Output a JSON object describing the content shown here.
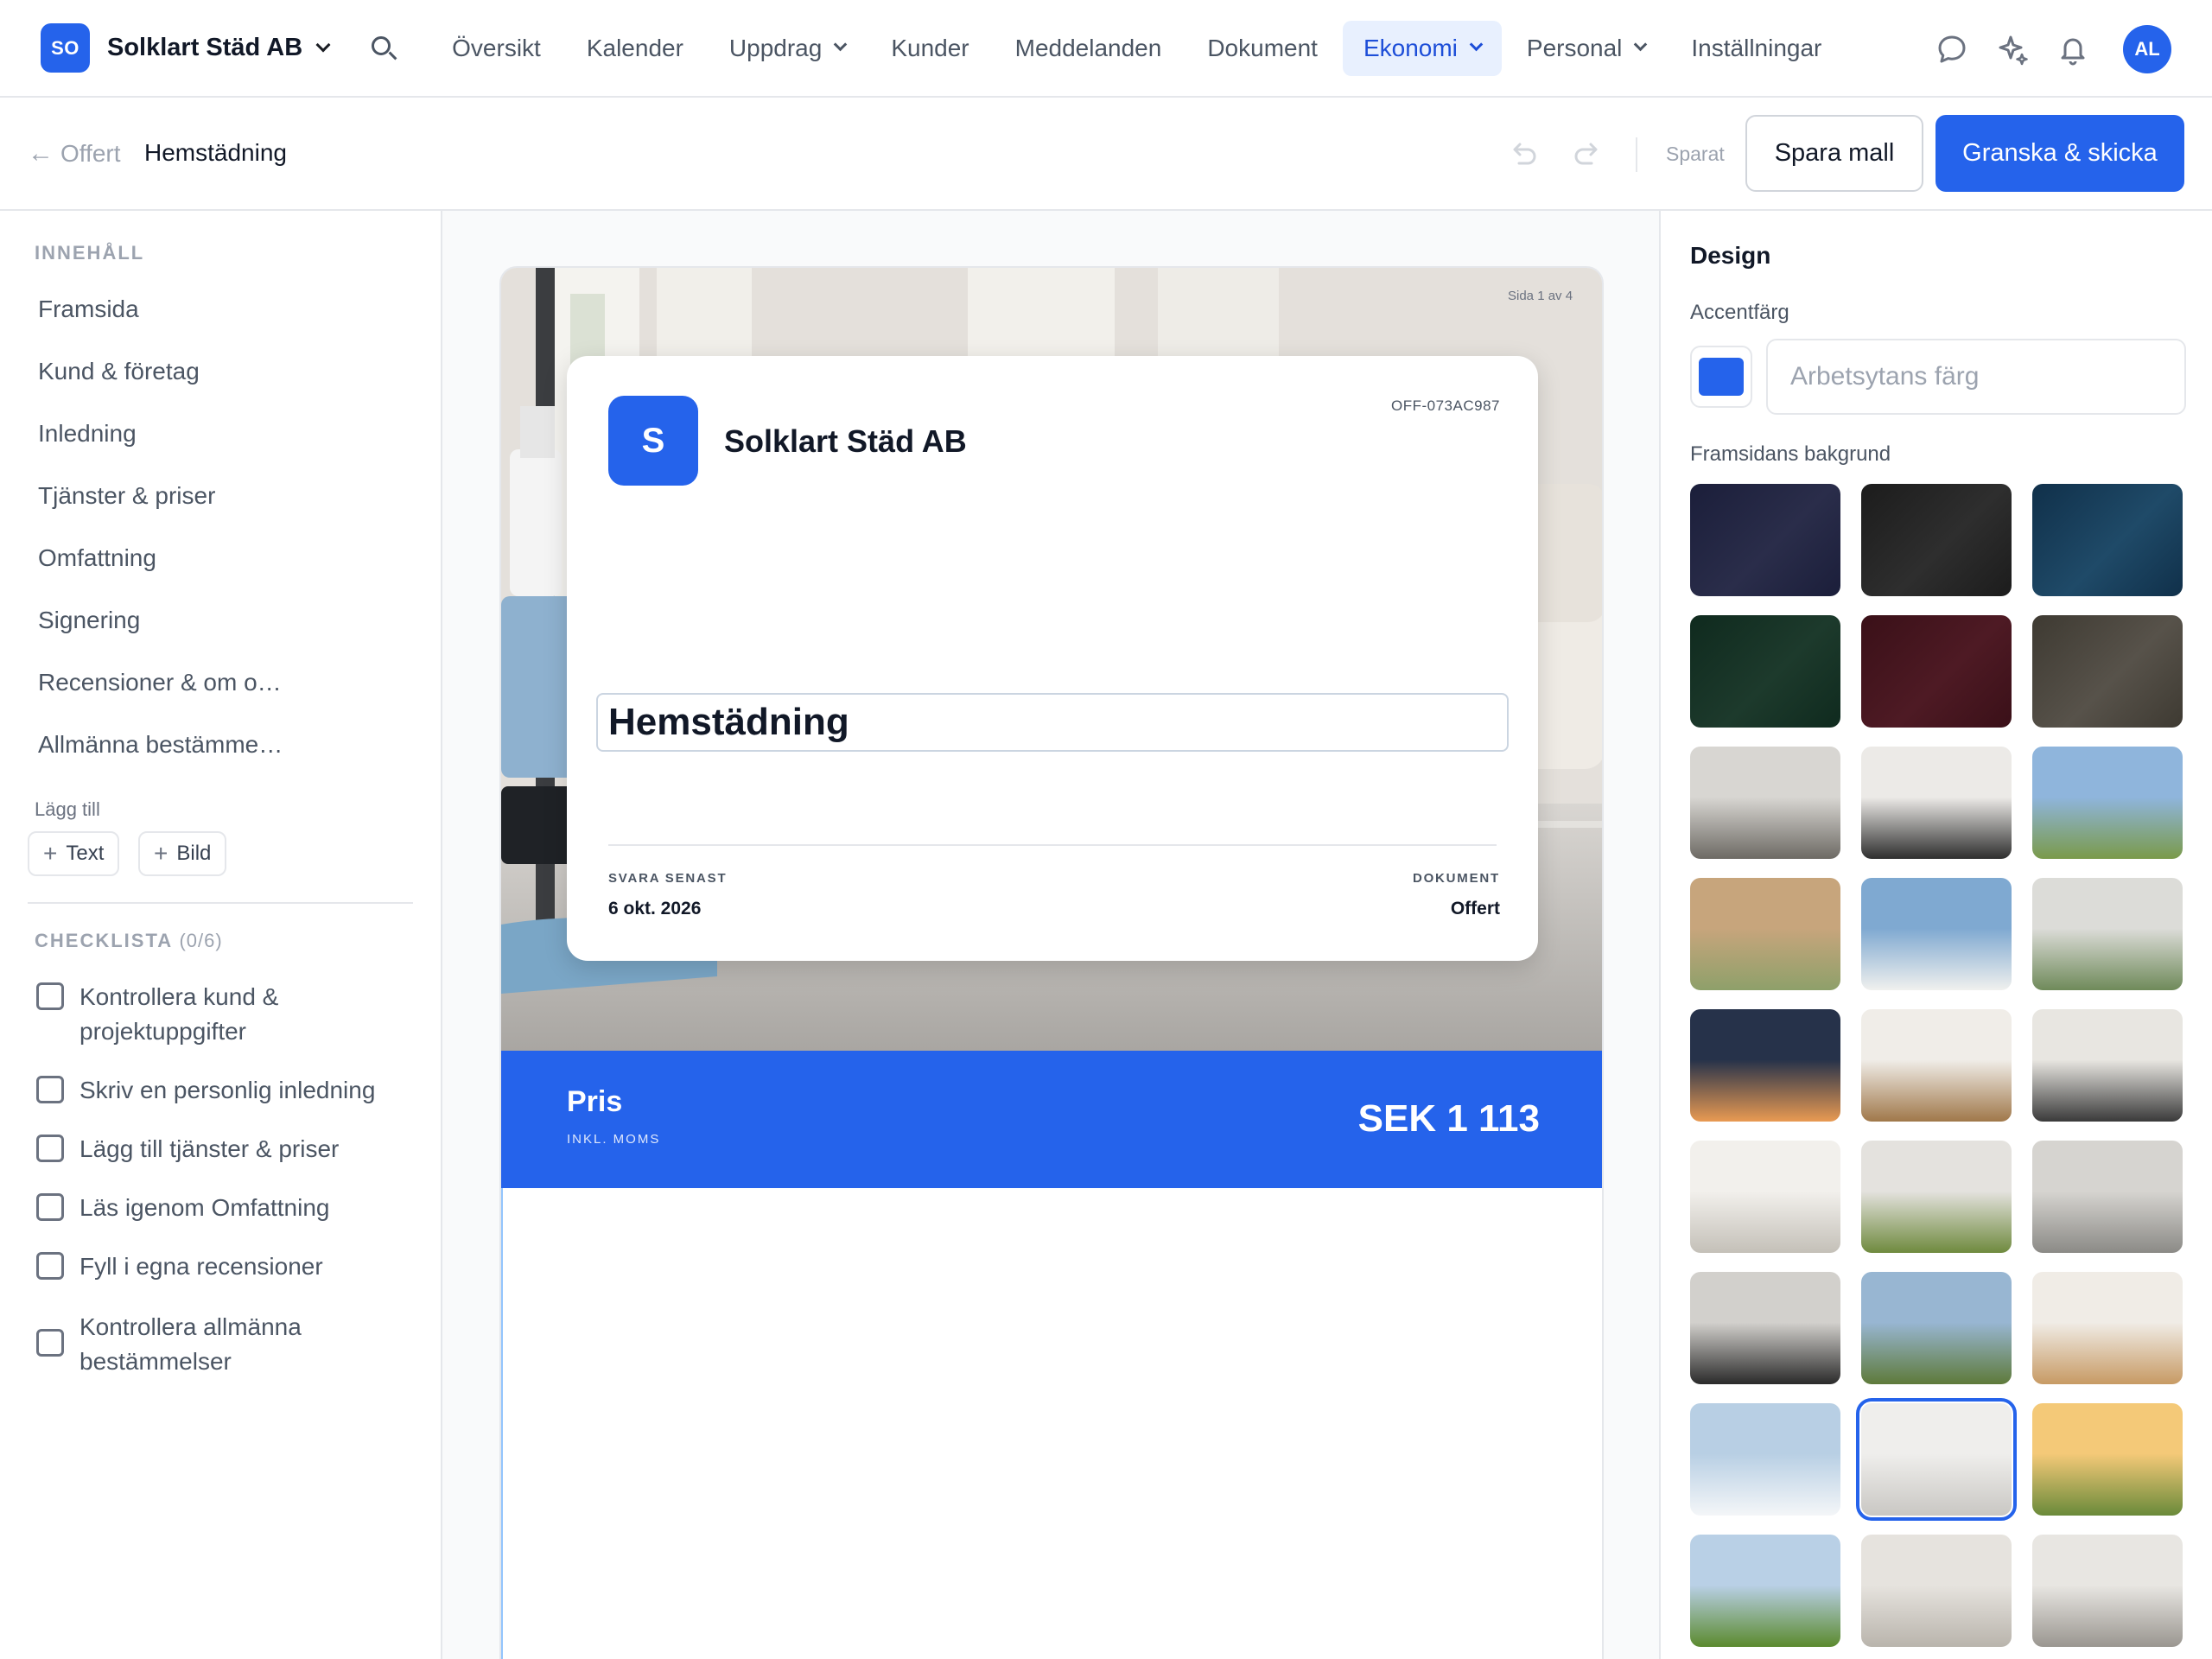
{
  "topnav": {
    "brand_initials": "SO",
    "brand_name": "Solklart Städ AB",
    "links": [
      "Översikt",
      "Kalender",
      "Uppdrag",
      "Kunder",
      "Meddelanden",
      "Dokument",
      "Ekonomi",
      "Personal",
      "Inställningar"
    ],
    "active_link": "Ekonomi",
    "avatar_initials": "AL",
    "icons": [
      "search-icon",
      "chat-icon",
      "sparkle-icon",
      "bell-icon"
    ]
  },
  "subbar": {
    "back_label": "Offert",
    "title": "Hemstädning",
    "saved_label": "Sparat",
    "save_template_label": "Spara mall",
    "review_send_label": "Granska & skicka"
  },
  "sidebar": {
    "content_title": "INNEHÅLL",
    "items": [
      "Framsida",
      "Kund & företag",
      "Inledning",
      "Tjänster & priser",
      "Omfattning",
      "Signering",
      "Recensioner & om o…",
      "Allmänna bestämme…"
    ],
    "add_label": "Lägg till",
    "add_text_label": "Text",
    "add_image_label": "Bild",
    "checklist_title": "CHECKLISTA",
    "checklist_count": "(0/6)",
    "checklist": [
      {
        "text": "Kontrollera kund & projektuppgifter",
        "checked": false
      },
      {
        "text": "Skriv en personlig inledning",
        "checked": false
      },
      {
        "text": "Lägg till tjänster & priser",
        "checked": false
      },
      {
        "text": "Läs igenom Omfattning",
        "checked": false
      },
      {
        "text": "Fyll i egna recensioner",
        "checked": false
      },
      {
        "text": "Kontrollera allmänna bestämmelser",
        "checked": false
      }
    ]
  },
  "document": {
    "page_indicator": "Sida 1 av 4",
    "logo_letter": "S",
    "company": "Solklart Städ AB",
    "reference": "OFF-073AC987",
    "title": "Hemstädning",
    "reply_by_label": "SVARA SENAST",
    "reply_by_value": "6 okt. 2026",
    "doc_type_label": "DOKUMENT",
    "doc_type_value": "Offert",
    "price_label": "Pris",
    "price_sub": "INKL. MOMS",
    "price_value": "SEK 1 113"
  },
  "design_panel": {
    "title": "Design",
    "accent_label": "Accentfärg",
    "accent_color": "#2563eb",
    "accent_placeholder": "Arbetsytans färg",
    "bg_label": "Framsidans bakgrund",
    "backgrounds": [
      {
        "name": "navy",
        "colors": [
          "#1b1e3a",
          "#2a2d4a"
        ]
      },
      {
        "name": "black",
        "colors": [
          "#1c1c1c",
          "#2e2e2e"
        ]
      },
      {
        "name": "petrol",
        "colors": [
          "#10304a",
          "#1f4a68"
        ]
      },
      {
        "name": "forest",
        "colors": [
          "#0f2a1e",
          "#1d3a2c"
        ]
      },
      {
        "name": "wine",
        "colors": [
          "#3a1018",
          "#4e1a24"
        ]
      },
      {
        "name": "taupe",
        "colors": [
          "#3e3a32",
          "#57524a"
        ]
      },
      {
        "name": "water-damage",
        "colors": [
          "#d8d6d2",
          "#6d6a64"
        ]
      },
      {
        "name": "door-frame",
        "colors": [
          "#eceae7",
          "#2e2e2e"
        ]
      },
      {
        "name": "apartment-trees",
        "colors": [
          "#8fb5dc",
          "#7a9a4a"
        ]
      },
      {
        "name": "moving-boxes",
        "colors": [
          "#c7a57c",
          "#8ea06a"
        ]
      },
      {
        "name": "window-view",
        "colors": [
          "#7fa9d1",
          "#f0f0ee"
        ]
      },
      {
        "name": "tools-desk",
        "colors": [
          "#dcdcd8",
          "#6f8a5a"
        ]
      },
      {
        "name": "sunset-van",
        "colors": [
          "#26324a",
          "#e99a52"
        ]
      },
      {
        "name": "white-wall",
        "colors": [
          "#f0ede8",
          "#a0784a"
        ]
      },
      {
        "name": "hallway",
        "colors": [
          "#e8e6e1",
          "#3a3a3a"
        ]
      },
      {
        "name": "room-ladder",
        "colors": [
          "#f2f0ec",
          "#c4c0b8"
        ]
      },
      {
        "name": "garden-plants",
        "colors": [
          "#e4e2de",
          "#6f8a3e"
        ]
      },
      {
        "name": "tiles",
        "colors": [
          "#d6d4d0",
          "#8b8a86"
        ]
      },
      {
        "name": "dark-floor",
        "colors": [
          "#d2d0cc",
          "#2a2a2a"
        ]
      },
      {
        "name": "pressure-wash",
        "colors": [
          "#98b6d2",
          "#5e7a3a"
        ]
      },
      {
        "name": "wood-chips",
        "colors": [
          "#f0ece6",
          "#c79a64"
        ]
      },
      {
        "name": "snow-blower",
        "colors": [
          "#b8cfe4",
          "#f4f6f8"
        ]
      },
      {
        "name": "clean-living-room",
        "colors": [
          "#efeeec",
          "#c9c7c3"
        ]
      },
      {
        "name": "tree-sun",
        "colors": [
          "#f4c978",
          "#6a8a3a"
        ]
      },
      {
        "name": "lawn-garden",
        "colors": [
          "#b9d0e6",
          "#5b8a2e"
        ]
      },
      {
        "name": "bathroom",
        "colors": [
          "#e6e3de",
          "#b9b4ac"
        ]
      },
      {
        "name": "heat-pump",
        "colors": [
          "#e8e6e2",
          "#9a9690"
        ]
      }
    ],
    "selected_background": "clean-living-room"
  }
}
